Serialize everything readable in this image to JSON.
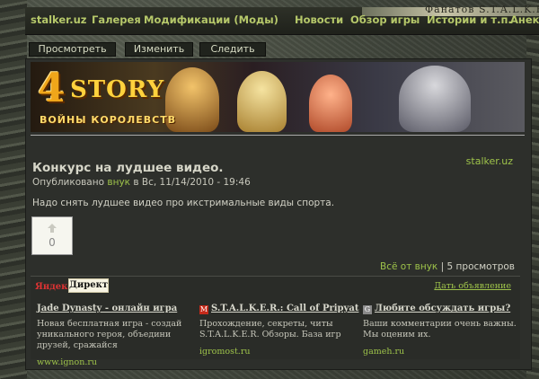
{
  "header": {
    "banner_text": "Фанатов S.T.A.L.K.E.R.",
    "nav_items": [
      {
        "label": "stalker.uz"
      },
      {
        "label": "Галерея"
      },
      {
        "label": "Модификации (Моды)"
      },
      {
        "label": "Новости"
      },
      {
        "label": "Обзор игры"
      },
      {
        "label": "Истории и т.п."
      },
      {
        "label": "Анекд"
      }
    ]
  },
  "tabs": [
    {
      "label": "Просмотреть"
    },
    {
      "label": "Изменить"
    },
    {
      "label": "Следить"
    }
  ],
  "banner": {
    "number": "4",
    "name": "STORY",
    "subtitle": "ВОЙНЫ КОРОЛЕВСТВ"
  },
  "post": {
    "site_link": "stalker.uz",
    "title": "Конкурс на лудшее видео.",
    "meta_prefix": "Опубликовано",
    "author": "внук",
    "meta_suffix": "в Вс, 11/14/2010 - 19:46",
    "body": "Надо снять лудшее видео про икстримальные виды спорта.",
    "vote_count": "0",
    "all_from_user": "Всё от внук",
    "separator": "|",
    "views": "5 просмотров"
  },
  "ads": {
    "yandex_label": "Яндекс",
    "direct_label": "Директ",
    "post_ad_label": "Дать объявление",
    "items": [
      {
        "title": "Jade Dynasty - онлайн игра",
        "text": "Новая бесплатная игра - создай уникального героя, объедини друзей, сражайся",
        "url": "www.ignon.ru",
        "icon": "none"
      },
      {
        "title": "S.T.A.L.K.E.R.: Call of Pripyat",
        "text": "Прохождение, секреты, читы S.T.A.L.K.E.R. Обзоры. База игр",
        "url": "igromost.ru",
        "icon": "igromost-favicon"
      },
      {
        "title": "Любите обсуждать игры?",
        "text": "Ваши комментарии очень важны. Мы оценим их.",
        "url": "gameh.ru",
        "icon": "gameh-favicon"
      }
    ]
  },
  "colors": {
    "accent_green": "#9ec34a",
    "panel_bg": "#2d2f2b",
    "nav_text": "#b6c86a"
  }
}
